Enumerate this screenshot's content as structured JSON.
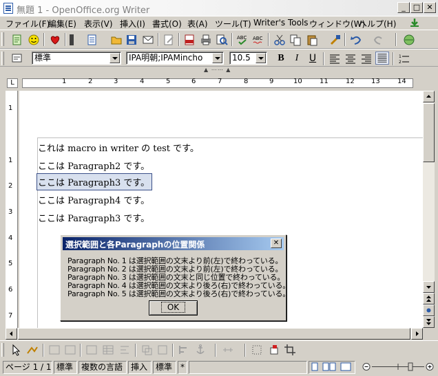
{
  "window": {
    "title": "無題 1 - OpenOffice.org Writer",
    "minimize": "_",
    "maximize": "□",
    "close": "✕"
  },
  "menu": [
    {
      "label": "ファイル(F)"
    },
    {
      "label": "編集(E)"
    },
    {
      "label": "表示(V)"
    },
    {
      "label": "挿入(I)"
    },
    {
      "label": "書式(O)"
    },
    {
      "label": "表(A)"
    },
    {
      "label": "ツール(T)"
    },
    {
      "label": "Writer's Tools"
    },
    {
      "label": "ウィンドウ(W)"
    },
    {
      "label": "ヘルプ(H)"
    }
  ],
  "formatting": {
    "style": "標準",
    "font": "IPA明朝;IPAMincho",
    "size": "10.5",
    "bold": "B",
    "italic": "I",
    "underline": "U"
  },
  "ruler": {
    "h_numbers": [
      "1",
      "2",
      "3",
      "4",
      "5",
      "6",
      "7",
      "8",
      "9",
      "10",
      "11",
      "12",
      "13",
      "14"
    ],
    "v_numbers": [
      "1",
      "1",
      "2",
      "3",
      "4",
      "5",
      "6",
      "7"
    ]
  },
  "document": {
    "paragraphs": [
      "これは macro in writer の test です。",
      "ここは Paragraph2 です。",
      "ここは Paragraph3 です。",
      "ここは Paragraph4 です。",
      "ここは Paragraph3 です。"
    ]
  },
  "dialog": {
    "title": "選択範囲と各Paragraphの位置関係",
    "close": "✕",
    "lines": [
      "Paragraph No. 1 は選択範囲の文末より前(左)で終わっている。",
      "Paragraph No. 2 は選択範囲の文末より前(左)で終わっている。",
      "Paragraph No. 3 は選択範囲の文末と同じ位置で終わっている。",
      "Paragraph No. 4 は選択範囲の文末より後ろ(右)で終わっている。",
      "Paragraph No. 5 は選択範囲の文末より後ろ(右)で終わっている。"
    ],
    "ok": "OK"
  },
  "status": {
    "page": "ページ 1 / 1",
    "style": "標準",
    "language": "複数の言語",
    "insert_mode": "挿入",
    "selection_mode": "標準",
    "modified": "*"
  },
  "colors": {
    "titlebar_gradient_start": "#0a246a",
    "selection_outline": "#3a4f88",
    "chrome": "#d4d0c8"
  }
}
